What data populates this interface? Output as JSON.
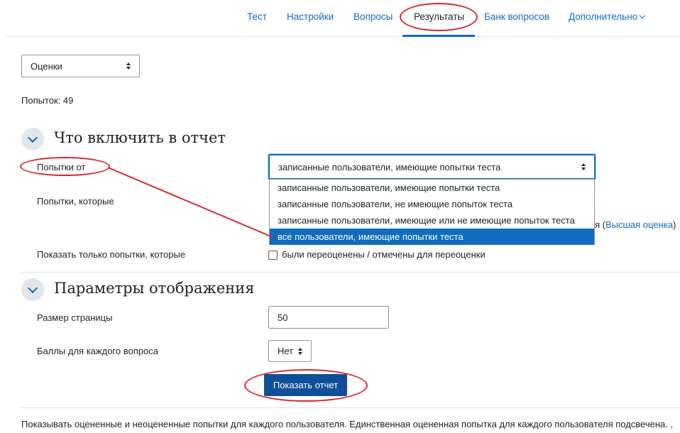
{
  "nav": {
    "items": [
      {
        "label": "Тест"
      },
      {
        "label": "Настройки"
      },
      {
        "label": "Вопросы"
      },
      {
        "label": "Результаты"
      },
      {
        "label": "Банк вопросов"
      },
      {
        "label": "Дополнительно"
      }
    ],
    "active": "Результаты"
  },
  "report_select": {
    "value": "Оценки"
  },
  "attempts_count": "Попыток: 49",
  "section_include": {
    "title": "Что включить в отчет",
    "attempts_from_label": "Попытки от",
    "attempts_from_value": "записанные пользователи, имеющие попытки теста",
    "dropdown_options": [
      "записанные пользователи, имеющие попытки теста",
      "записанные пользователи, не имеющие попыток теста",
      "записанные пользователи, имеющие или не имеющие попыток теста",
      "все пользователи, имеющие попытки теста"
    ],
    "dropdown_selected_index": 3,
    "attempts_which_label": "Попытки, которые",
    "hidden_text_fragment": "я (",
    "highest_grade_link": "Высшая оценка",
    "hidden_text_close": ")",
    "show_only_label": "Показать только попытки, которые",
    "regraded_checkbox_label": "были переоценены / отмечены для переоценки"
  },
  "section_display": {
    "title": "Параметры отображения",
    "page_size_label": "Размер страницы",
    "page_size_value": "50",
    "marks_label": "Баллы для каждого вопроса",
    "marks_value": "Нет",
    "show_report_button": "Показать отчет"
  },
  "footer_text": "Показывать оцененные и неоцененные попытки для каждого пользователя. Единственная оцененная попытка для каждого пользователя подсвечена. ,",
  "colors": {
    "link": "#0f6cbf",
    "primary_button": "#0f4f9a",
    "annotation_red": "#d7272f"
  }
}
